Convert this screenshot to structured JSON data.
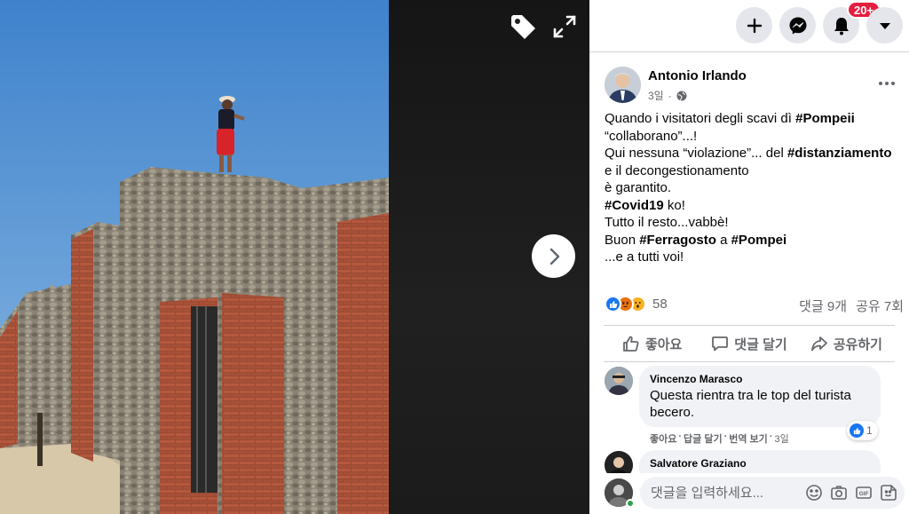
{
  "viewer": {
    "tag_icon": "tag-icon",
    "expand_icon": "expand-icon",
    "next_icon": "chevron-right-icon"
  },
  "topbar": {
    "create_icon": "plus-icon",
    "messenger_icon": "messenger-icon",
    "notifications_icon": "bell-icon",
    "notifications_badge": "20+",
    "account_icon": "caret-down-icon"
  },
  "post": {
    "author": "Antonio Irlando",
    "time": "3일",
    "audience_icon": "globe-icon",
    "more_icon": "more-horizontal-icon",
    "lines": [
      [
        {
          "t": "Quando i visitatori degli scavi dì "
        },
        {
          "t": "#Pompeii",
          "b": true
        }
      ],
      [
        {
          "t": "“collaborano”...!"
        }
      ],
      [
        {
          "t": "Qui nessuna “violazione”... del "
        },
        {
          "t": "#distanziamento",
          "b": true
        }
      ],
      [
        {
          "t": "e il decongestionamento"
        }
      ],
      [
        {
          "t": "è garantito."
        }
      ],
      [
        {
          "t": "#Covid19",
          "b": true
        },
        {
          "t": " ko!"
        }
      ],
      [
        {
          "t": "Tutto il resto...vabbè!"
        }
      ],
      [
        {
          "t": "Buon "
        },
        {
          "t": "#Ferragosto",
          "b": true
        },
        {
          "t": " a "
        },
        {
          "t": "#Pompei",
          "b": true
        }
      ],
      [
        {
          "t": "...e a tutti voi!"
        }
      ]
    ],
    "reaction_count": "58",
    "comments_count": "댓글 9개",
    "shares_count": "공유 7회",
    "colors": {
      "like": "#1877f2",
      "angry": "#e9710f",
      "wow": "#f7b125"
    }
  },
  "actions": {
    "like": "좋아요",
    "comment": "댓글 달기",
    "share": "공유하기"
  },
  "comments": [
    {
      "name": "Vincenzo Marasco",
      "text_lines": [
        "Questa rientra tra le top del turista",
        "becero."
      ],
      "like": "좋아요",
      "reply": "답글 달기",
      "translate": "번역 보기",
      "time": "3일",
      "reaction_count": "1"
    },
    {
      "name": "Salvatore Graziano"
    }
  ],
  "composer": {
    "placeholder": "댓글을 입력하세요...",
    "icons": [
      "emoji-icon",
      "camera-icon",
      "gif-icon",
      "sticker-icon"
    ]
  }
}
